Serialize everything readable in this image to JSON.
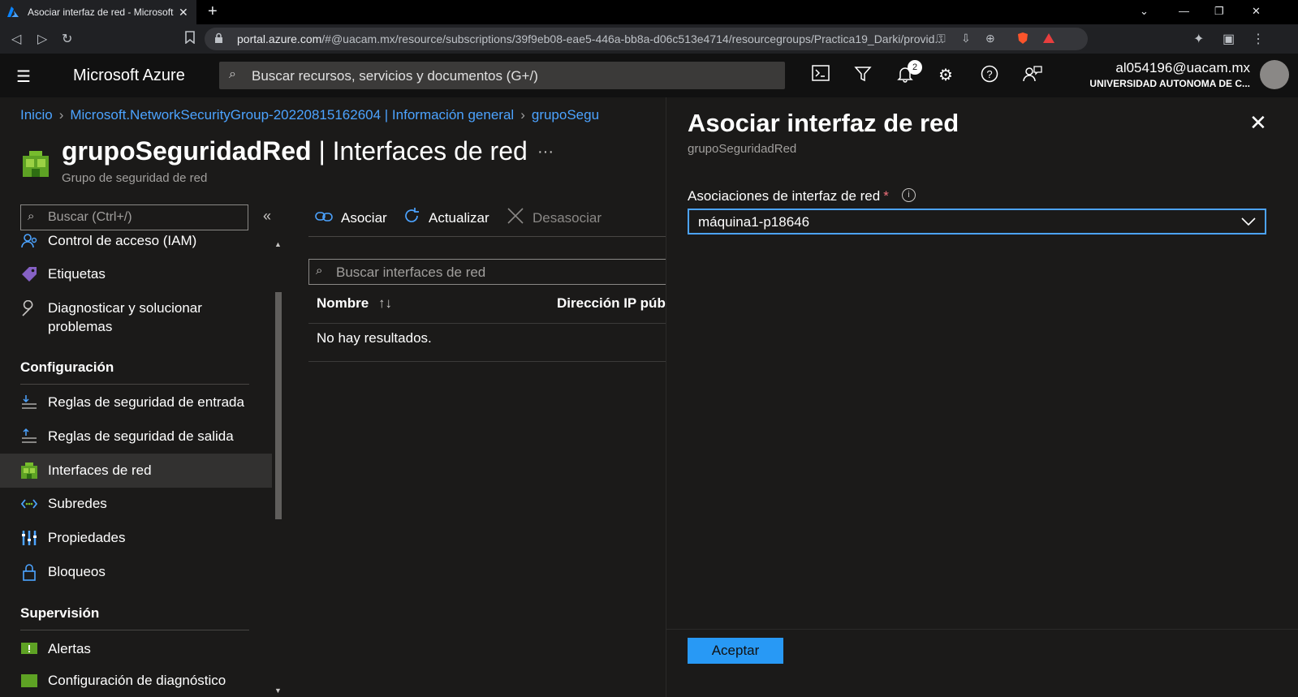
{
  "browser": {
    "tab_title": "Asociar interfaz de red - Microsoft Azure",
    "tab_close": "✕",
    "new_tab": "+",
    "url_host": "portal.azure.com",
    "url_path": "/#@uacam.mx/resource/subscriptions/39f9eb08-eae5-446a-bb8a-d06c513e4714/resourcegroups/Practica19_Darki/provid..."
  },
  "header": {
    "brand": "Microsoft Azure",
    "search_placeholder": "Buscar recursos, servicios y documentos (G+/)",
    "notifications_count": "2",
    "user_email": "al054196@uacam.mx",
    "user_org": "UNIVERSIDAD AUTONOMA DE C..."
  },
  "breadcrumb": {
    "items": [
      "Inicio",
      "Microsoft.NetworkSecurityGroup-20220815162604 | Información general",
      "grupoSegu"
    ]
  },
  "resource": {
    "name": "grupoSeguridadRed",
    "section": " | Interfaces de red",
    "type": "Grupo de seguridad de red",
    "more": "···"
  },
  "menu": {
    "search_placeholder": "Buscar (Ctrl+/)",
    "collapse": "«",
    "items_top": [
      {
        "label": "Control de acceso (IAM)",
        "icon": "iam-icon"
      },
      {
        "label": "Etiquetas",
        "icon": "tag-icon"
      },
      {
        "label": "Diagnosticar y solucionar",
        "label2": "problemas",
        "icon": "wrench-icon"
      }
    ],
    "section_config": "Configuración",
    "items_config": [
      {
        "label": "Reglas de seguridad de entrada",
        "icon": "inbound-rules-icon"
      },
      {
        "label": "Reglas de seguridad de salida",
        "icon": "outbound-rules-icon"
      },
      {
        "label": "Interfaces de red",
        "icon": "network-interface-icon",
        "selected": true
      },
      {
        "label": "Subredes",
        "icon": "subnet-icon"
      },
      {
        "label": "Propiedades",
        "icon": "properties-icon"
      },
      {
        "label": "Bloqueos",
        "icon": "lock-icon"
      }
    ],
    "section_monitor": "Supervisión",
    "items_monitor": [
      {
        "label": "Alertas",
        "icon": "alert-icon"
      },
      {
        "label": "Configuración de diagnóstico",
        "icon": "diagnostic-settings-icon"
      }
    ]
  },
  "toolbar": {
    "associate": "Asociar",
    "refresh": "Actualizar",
    "dissociate": "Desasociar"
  },
  "grid": {
    "filter_placeholder": "Buscar interfaces de red",
    "columns": [
      "Nombre",
      "Dirección IP públ"
    ],
    "empty_message": "No hay resultados."
  },
  "panel": {
    "title": "Asociar interfaz de red",
    "subtitle": "grupoSeguridadRed",
    "field_label": "Asociaciones de interfaz de red",
    "required_mark": "*",
    "info": "i",
    "selected_value": "máquina1-p18646",
    "accept": "Aceptar",
    "close": "✕"
  },
  "colors": {
    "accent": "#2899f5",
    "link": "#4ca3ff",
    "background": "#1b1a19",
    "header": "#111111"
  }
}
